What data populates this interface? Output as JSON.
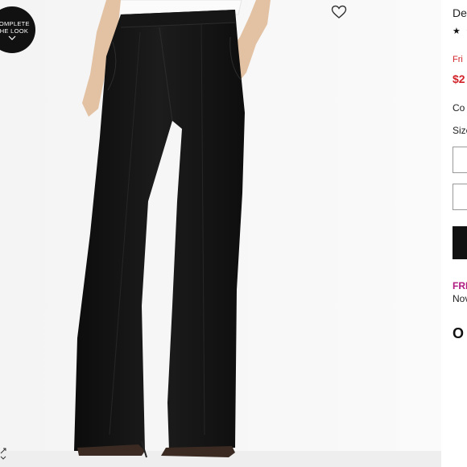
{
  "colors": {
    "accent": "#111111",
    "sale": "#d2232a",
    "shipping": "#b0197f",
    "background": "#f6f6f6"
  },
  "gallery": {
    "complete_look": {
      "line1": "COMPLETE",
      "line2": "THE LOOK",
      "icon": "chevron-down-icon"
    },
    "favorite_icon": "heart-icon",
    "expand_icon": "expand-icon"
  },
  "product": {
    "brand": "De",
    "rating": "★ ★",
    "sale_tag": "Fri",
    "price": "$2",
    "color_label": "Co",
    "size_label": "Size",
    "shipping_label": "FRI",
    "shipping_note": "Nov",
    "section_title": "O"
  }
}
